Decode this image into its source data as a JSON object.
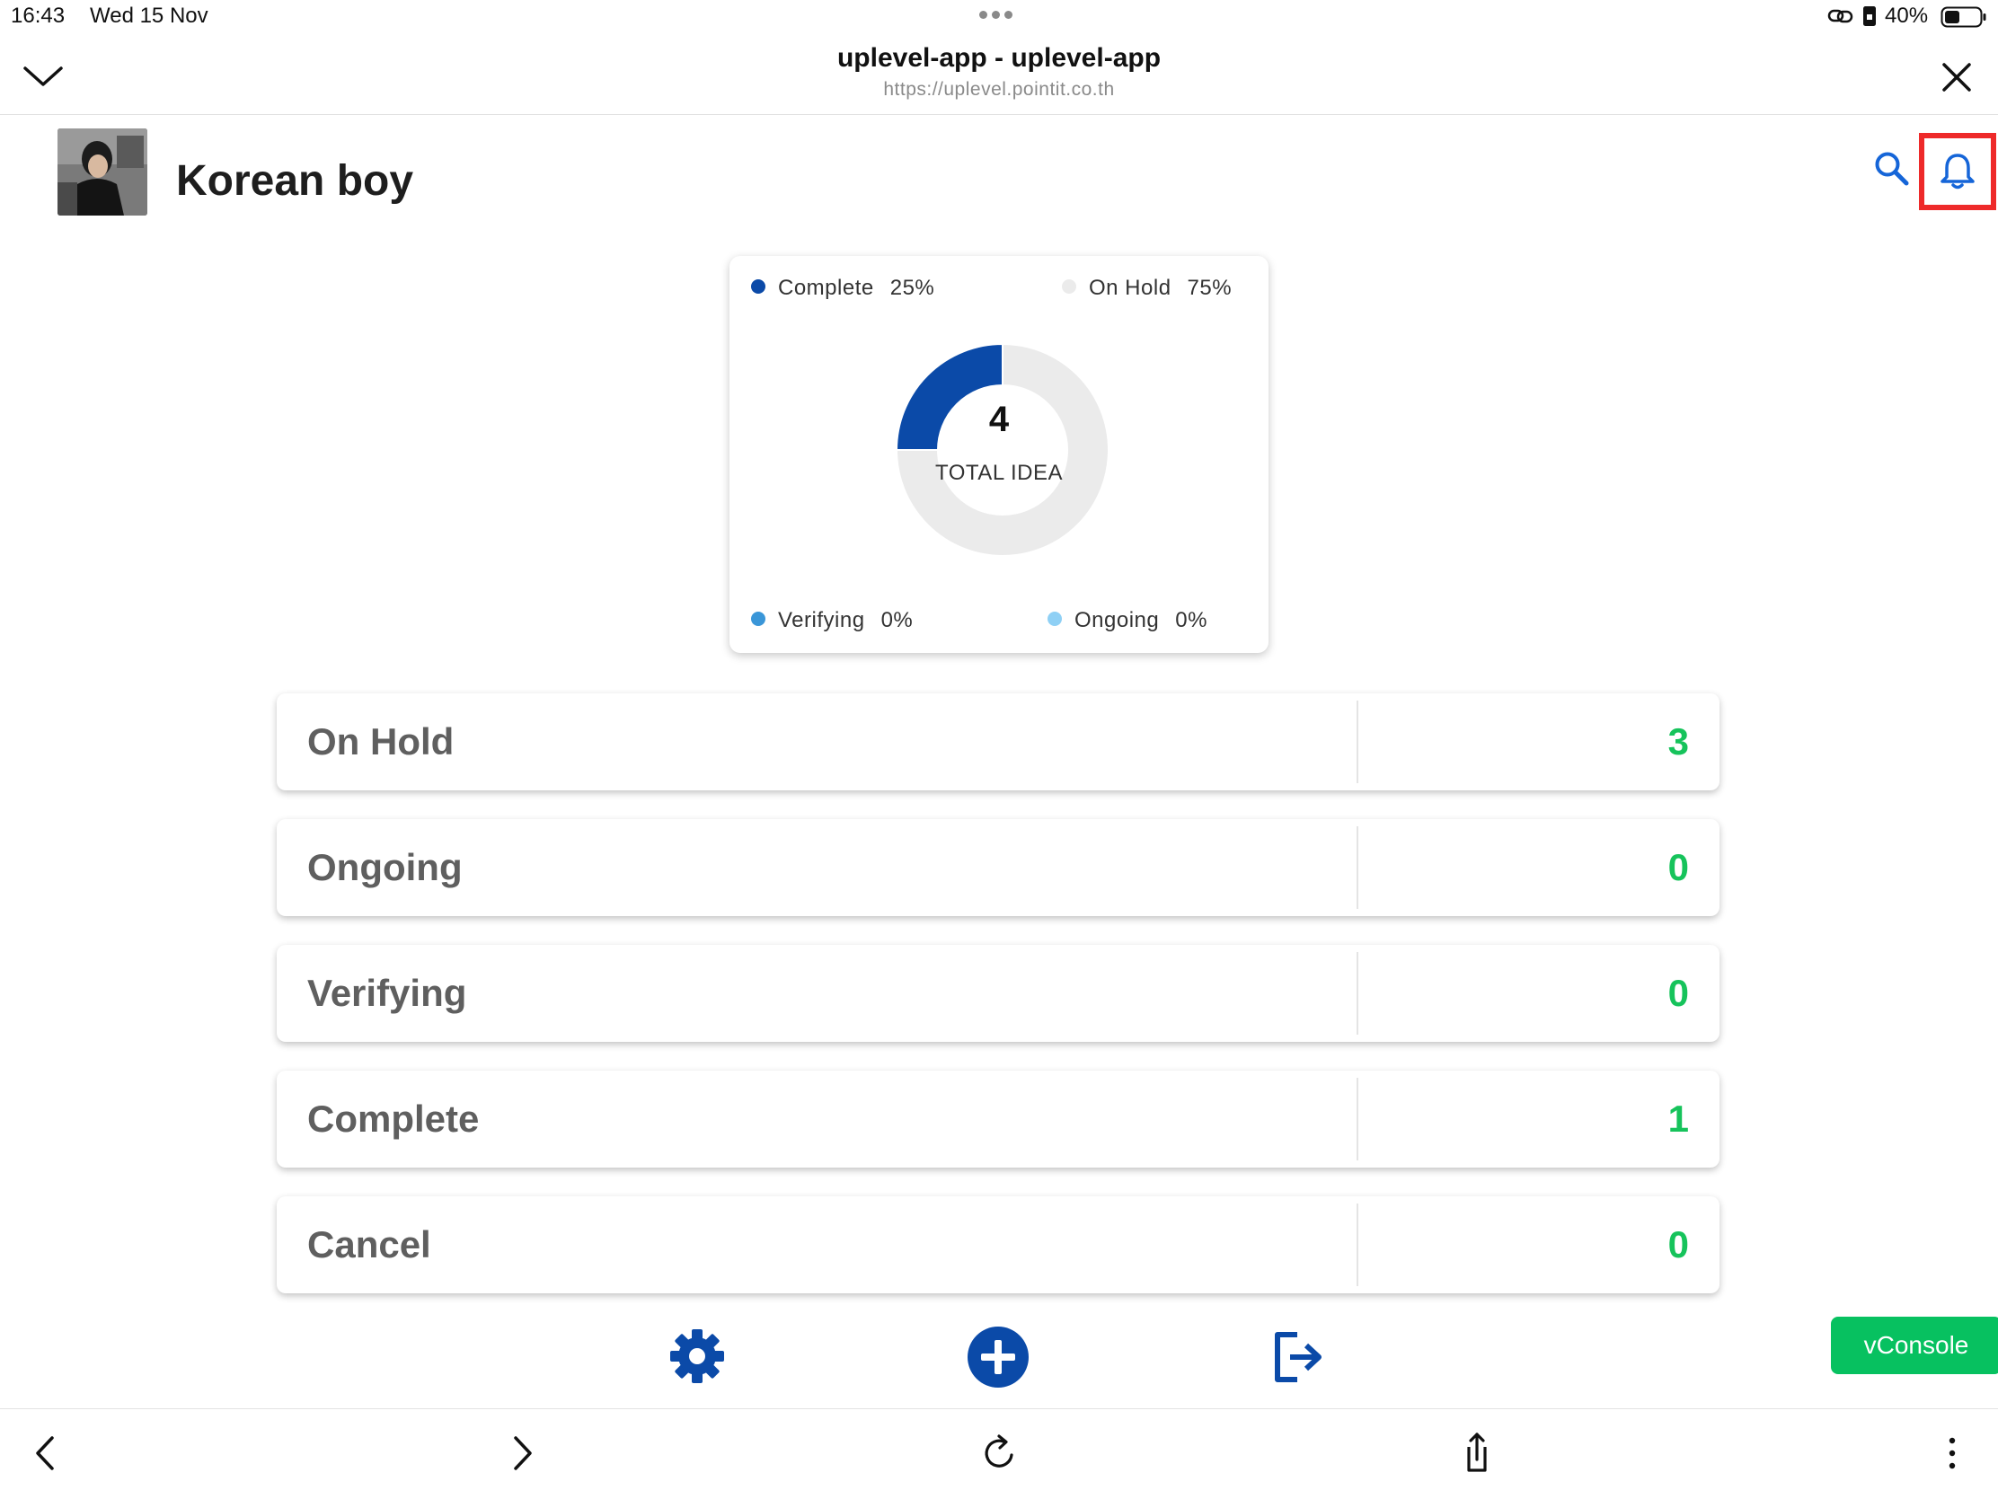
{
  "status_bar": {
    "time": "16:43",
    "date": "Wed 15 Nov",
    "battery": "40%"
  },
  "browser": {
    "title": "uplevel-app - uplevel-app",
    "url": "https://uplevel.pointit.co.th"
  },
  "profile": {
    "name": "Korean boy"
  },
  "chart_data": {
    "type": "pie",
    "center_value": "4",
    "center_label": "TOTAL IDEA",
    "slices": [
      {
        "label": "Complete",
        "percent_text": "25%",
        "value": 25,
        "color": "#0b4aa8"
      },
      {
        "label": "On Hold",
        "percent_text": "75%",
        "value": 75,
        "color": "#ebebeb"
      },
      {
        "label": "Verifying",
        "percent_text": "0%",
        "value": 0,
        "color": "#3a96d8"
      },
      {
        "label": "Ongoing",
        "percent_text": "0%",
        "value": 0,
        "color": "#8fd0f5"
      }
    ]
  },
  "status_rows": [
    {
      "label": "On Hold",
      "count": "3"
    },
    {
      "label": "Ongoing",
      "count": "0"
    },
    {
      "label": "Verifying",
      "count": "0"
    },
    {
      "label": "Complete",
      "count": "1"
    },
    {
      "label": "Cancel",
      "count": "0"
    }
  ],
  "vconsole_label": "vConsole",
  "colors": {
    "brand_blue": "#0b4aa8",
    "count_green": "#16c35b",
    "highlight_red": "#ee2a2a",
    "vconsole_green": "#07c160"
  },
  "icons": {
    "collapse": "chevron-down-icon",
    "close": "close-icon",
    "search": "search-icon",
    "notification": "bell-icon",
    "settings": "gear-icon",
    "add": "plus-circle-icon",
    "logout": "logout-icon",
    "back": "chevron-left-icon",
    "forward": "chevron-right-icon",
    "reload": "reload-icon",
    "share": "share-icon",
    "more": "more-vertical-icon"
  }
}
